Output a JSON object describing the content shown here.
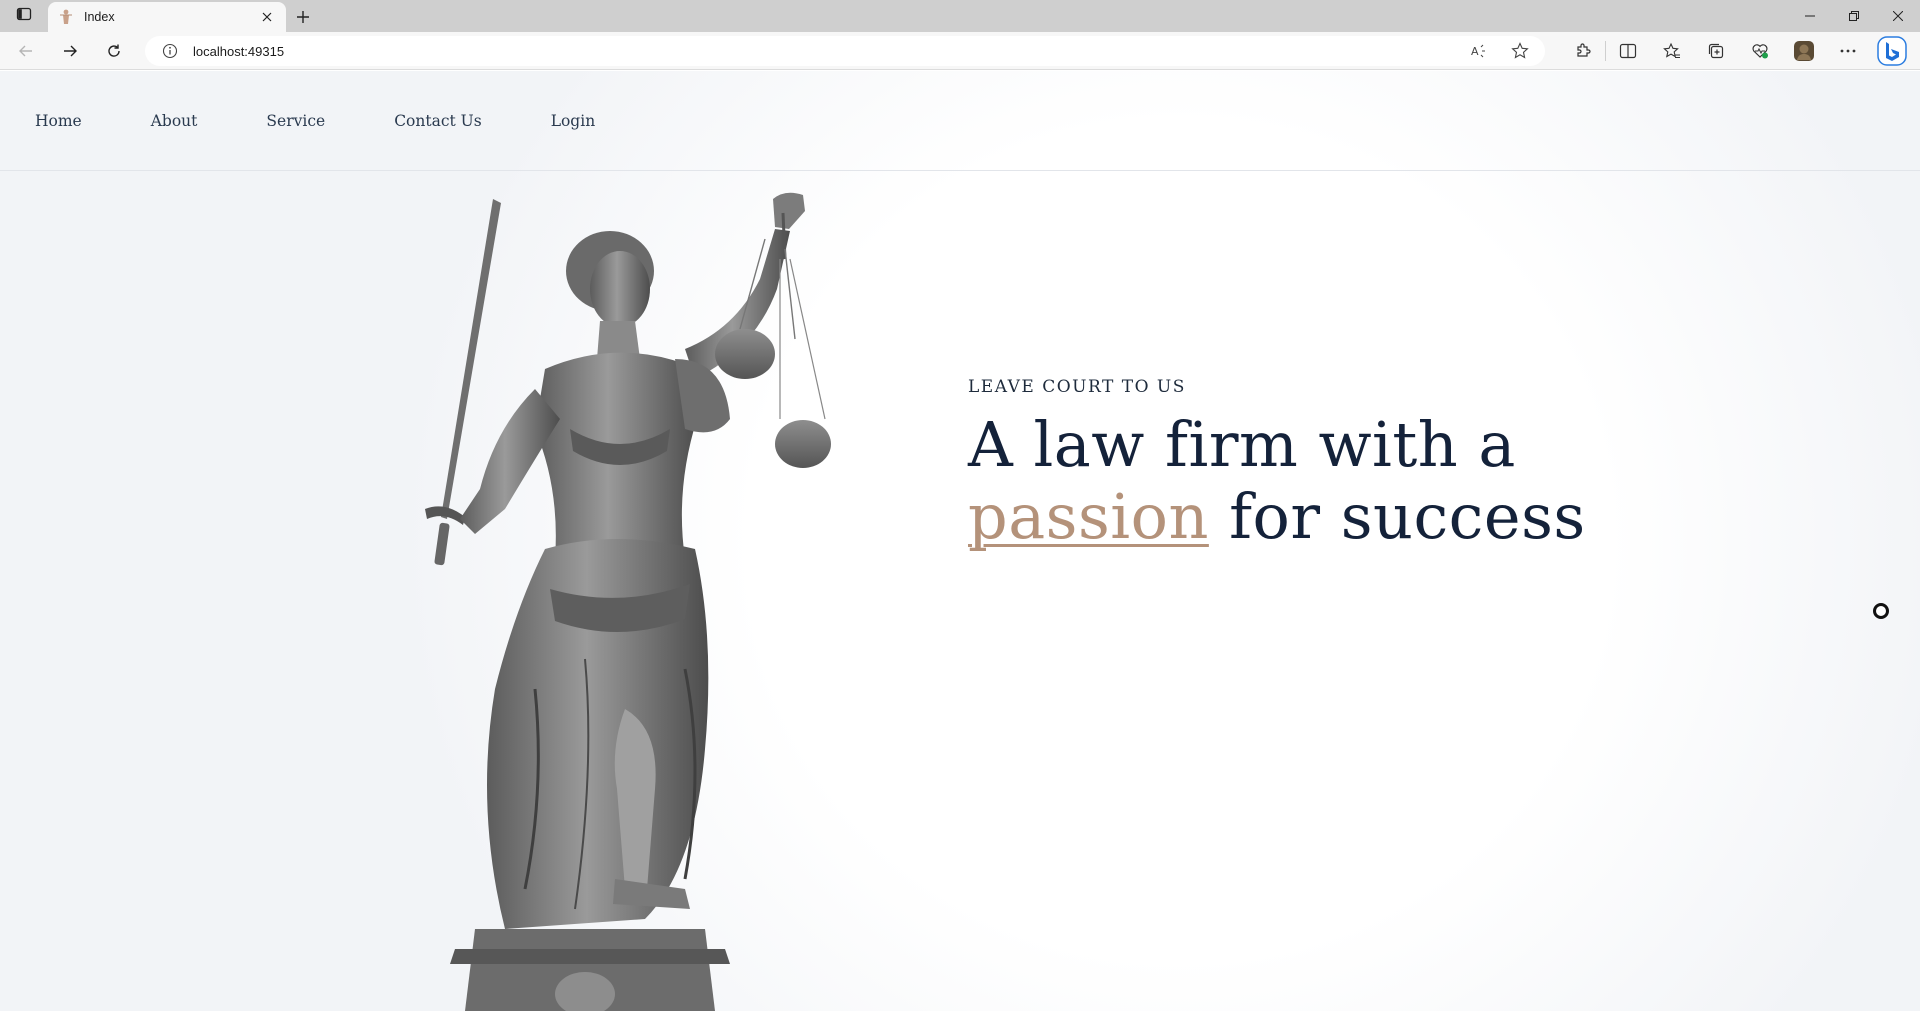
{
  "browser": {
    "tab_title": "Index",
    "url": "localhost:49315"
  },
  "icons": {
    "sidebar": "sidebar-toggle-icon",
    "favicon": "justice-favicon-icon",
    "close": "close-icon",
    "new_tab": "plus-icon",
    "back": "arrow-left-icon",
    "forward": "arrow-right-icon",
    "refresh": "refresh-icon",
    "info": "info-icon",
    "read_aloud": "read-aloud-icon",
    "favorite": "star-icon",
    "extensions": "puzzle-icon",
    "split": "split-screen-icon",
    "favorites": "favorites-icon",
    "collections": "collections-icon",
    "health": "heart-icon",
    "profile": "avatar-icon",
    "more": "more-icon",
    "copilot": "bing-icon"
  },
  "site": {
    "nav": [
      "Home",
      "About",
      "Service",
      "Contact Us",
      "Login"
    ],
    "hero": {
      "eyebrow": "LEAVE COURT TO US",
      "line1": "A law firm with a",
      "accent": "passion",
      "line2_rest": " for success"
    }
  },
  "colors": {
    "heading": "#14223a",
    "accent": "#b4927a",
    "nav_text": "#2a3a4f"
  }
}
